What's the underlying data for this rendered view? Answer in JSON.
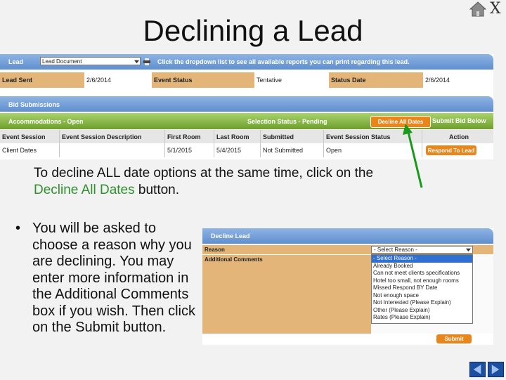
{
  "slide": {
    "title": "Declining a Lead",
    "close_label": "X",
    "instruction_prefix": "To decline ALL date options at the same time, click on the ",
    "instruction_highlight": "Decline All Dates",
    "instruction_suffix": " button.",
    "bullet": "You will be asked to choose a reason why you are declining. You may enter more information in the Additional Comments box if you wish. Then click on the Submit button."
  },
  "lead_bar": {
    "label": "Lead",
    "select_value": "Lead Document",
    "hint": "Click the dropdown list to see all available reports you can print regarding this lead."
  },
  "lead_info": {
    "lead_sent_label": "Lead Sent",
    "lead_sent_value": "2/6/2014",
    "event_status_label": "Event Status",
    "event_status_value": "Tentative",
    "status_date_label": "Status Date",
    "status_date_value": "2/6/2014"
  },
  "bid_bar": {
    "label": "Bid Submissions"
  },
  "accom_bar": {
    "label": "Accommodations - Open",
    "selection_status": "Selection Status - Pending",
    "decline_all_label": "Decline All Dates",
    "submit_bid_label": "Submit Bid Below"
  },
  "table": {
    "headers": [
      "Event Session",
      "Event Session Description",
      "First Room",
      "Last Room",
      "Submitted",
      "Event Session Status",
      "Action"
    ],
    "rows": [
      {
        "session": "Client Dates",
        "description": "",
        "first_room": "5/1/2015",
        "last_room": "5/4/2015",
        "submitted": "Not Submitted",
        "status": "Open",
        "action": "Respond To Lead"
      }
    ]
  },
  "decline_dialog": {
    "title": "Decline Lead",
    "reason_label": "Reason",
    "select_value": "- Select Reason -",
    "comments_label": "Additional Comments",
    "options": [
      "- Select Reason -",
      "Already Booked",
      "Can not meet clients specifications",
      "Hotel too small, not enough rooms",
      "Missed Respond BY Date",
      "Not enough space",
      "Not Interested (Please Explain)",
      "Other (Please Explain)",
      "Rates (Please Explain)"
    ],
    "submit_label": "Submit"
  },
  "colors": {
    "tan": "#e3b578",
    "orange": "#e8861c",
    "blue_bar": "#6f9bd6",
    "green_bar": "#8ab84a",
    "highlight_green": "#2f8f2f",
    "arrow_green": "#1a9a1a",
    "nav_blue": "#1c4fa0"
  },
  "icons": [
    "home-icon",
    "close-icon",
    "print-icon",
    "dropdown-arrow-icon",
    "prev-arrow-icon",
    "next-arrow-icon"
  ]
}
